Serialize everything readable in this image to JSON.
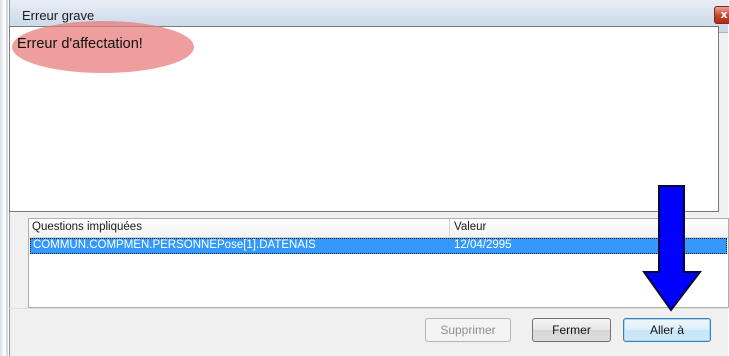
{
  "window": {
    "title": "Erreur grave",
    "close_glyph": "x"
  },
  "message": {
    "text": "Erreur d'affectation!",
    "highlight_color": "#e97878"
  },
  "table": {
    "columns": [
      "Questions impliquées",
      "Valeur"
    ],
    "rows": [
      {
        "question": "COMMUN.COMPMEN.PERSONNEPose[1].DATENAIS",
        "value": "12/04/2995",
        "selected": true
      }
    ],
    "selection_color": "#3399ff"
  },
  "buttons": {
    "supprimer": {
      "label": "Supprimer",
      "enabled": false
    },
    "fermer": {
      "label": "Fermer",
      "enabled": true
    },
    "aller": {
      "label": "Aller à",
      "enabled": true,
      "default": true
    }
  },
  "annotation": {
    "arrow_icon": "down-arrow-icon",
    "arrow_color": "#0000ff"
  }
}
